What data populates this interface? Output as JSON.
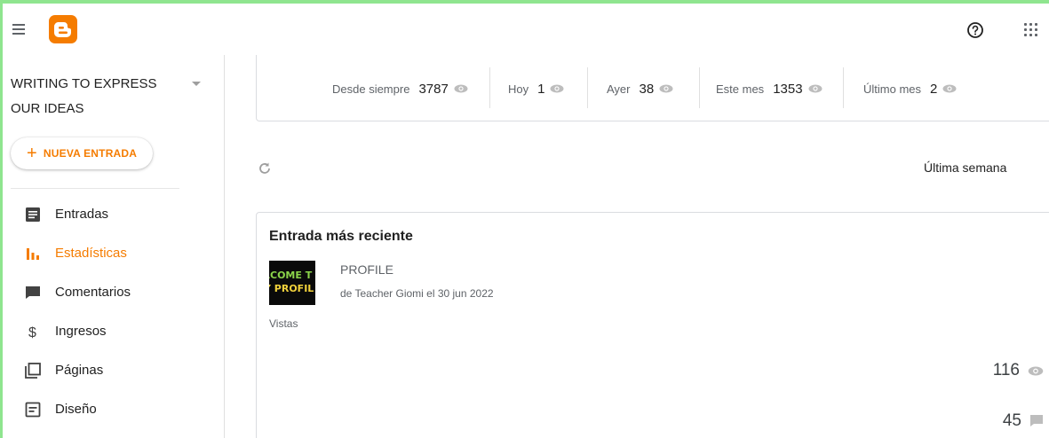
{
  "header": {
    "menu_icon": "hamburger-icon",
    "logo_icon": "blogger-logo-icon",
    "help_icon": "help-circle-icon",
    "apps_icon": "apps-grid-icon"
  },
  "sidebar": {
    "blog_title": "WRITING TO EXPRESS OUR IDEAS",
    "new_post_label": "NUEVA ENTRADA",
    "items": [
      {
        "label": "Entradas",
        "icon": "posts-icon"
      },
      {
        "label": "Estadísticas",
        "icon": "stats-icon",
        "active": true
      },
      {
        "label": "Comentarios",
        "icon": "comments-icon"
      },
      {
        "label": "Ingresos",
        "icon": "dollar-icon"
      },
      {
        "label": "Páginas",
        "icon": "pages-icon"
      },
      {
        "label": "Diseño",
        "icon": "layout-icon"
      }
    ]
  },
  "stats": [
    {
      "label": "Desde siempre",
      "value": "3787"
    },
    {
      "label": "Hoy",
      "value": "1"
    },
    {
      "label": "Ayer",
      "value": "38"
    },
    {
      "label": "Este mes",
      "value": "1353"
    },
    {
      "label": "Último mes",
      "value": "2"
    }
  ],
  "period": "Última semana",
  "recent": {
    "title": "Entrada más reciente",
    "thumbnail_text_1": "LCOME T",
    "thumbnail_text_2": "Y PROFIL",
    "post_title": "PROFILE",
    "post_meta": "de Teacher Giomi el 30 jun 2022",
    "views_label": "Vistas",
    "views_count": "116",
    "comments_count": "45"
  },
  "colors": {
    "accent": "#f57c00",
    "frame_border": "#8fe58f"
  }
}
